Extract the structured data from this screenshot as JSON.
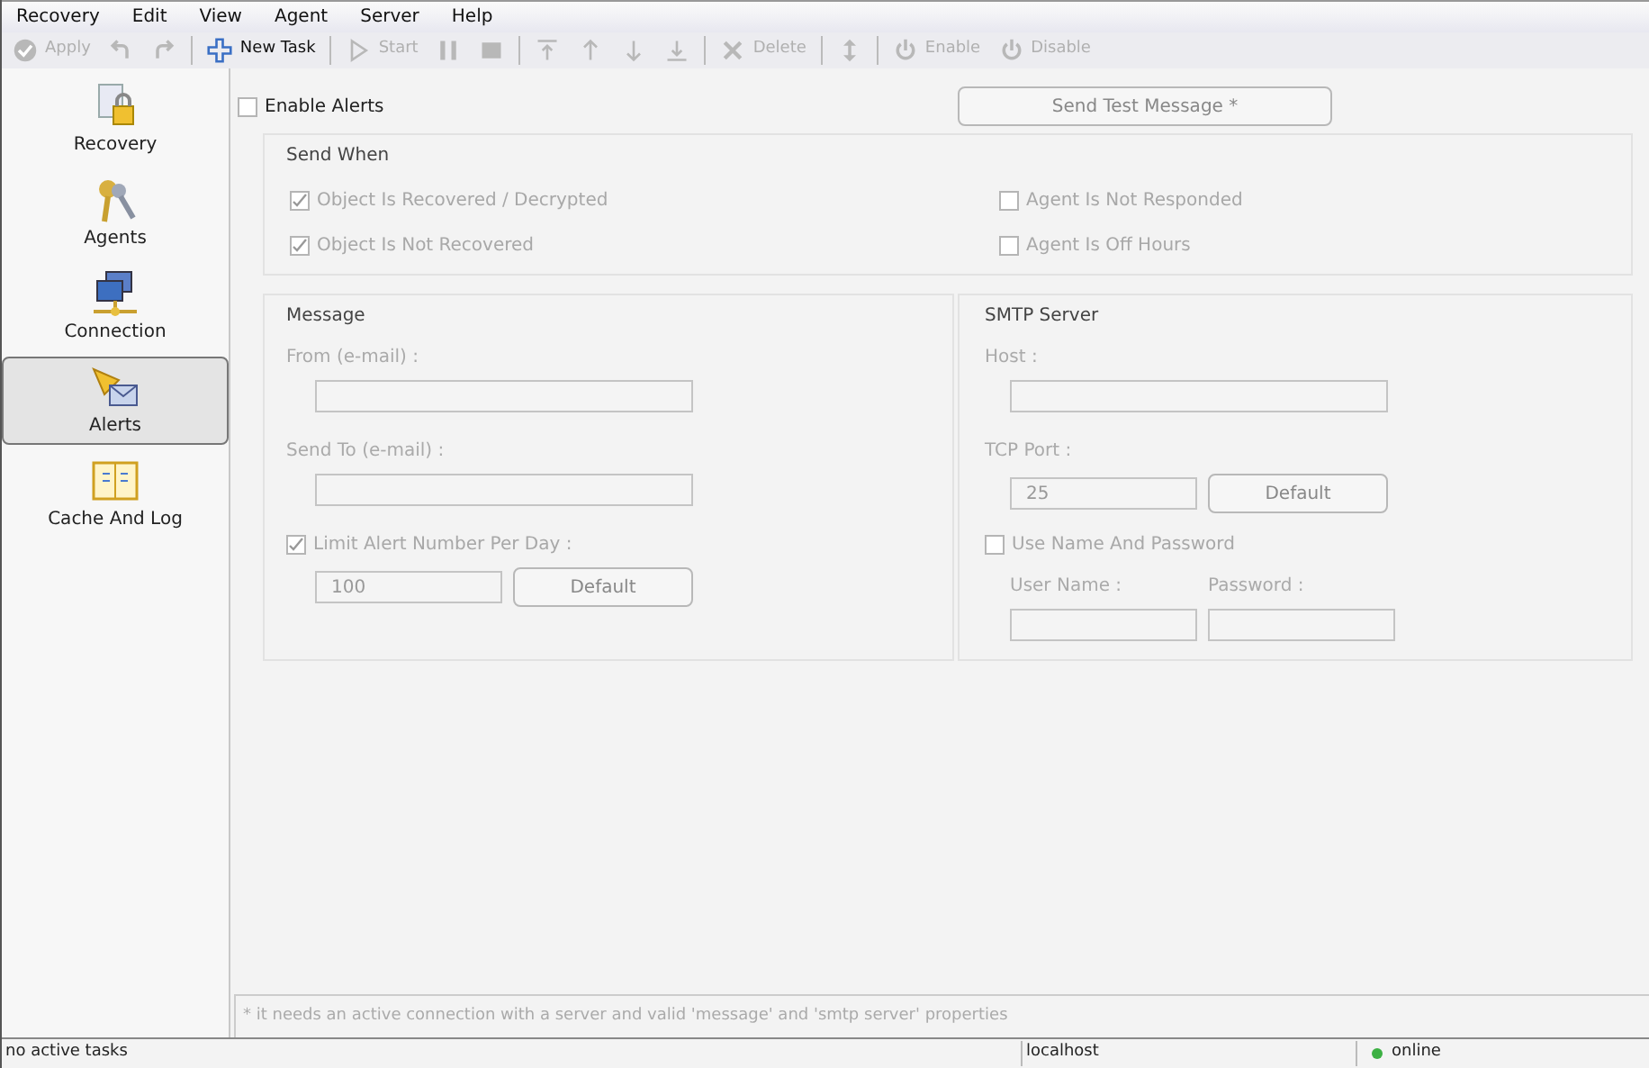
{
  "menu": [
    "Recovery",
    "Edit",
    "View",
    "Agent",
    "Server",
    "Help"
  ],
  "toolbar": [
    {
      "kind": "button",
      "label": "Apply",
      "disabled": true
    },
    {
      "kind": "icon",
      "disabled": true
    },
    {
      "kind": "icon",
      "disabled": true
    },
    {
      "kind": "sep"
    },
    {
      "kind": "button",
      "label": "New Task",
      "disabled": false
    },
    {
      "kind": "sep"
    },
    {
      "kind": "button",
      "label": "Start",
      "disabled": true
    },
    {
      "kind": "icon",
      "disabled": true
    },
    {
      "kind": "icon",
      "disabled": true
    },
    {
      "kind": "sep"
    },
    {
      "kind": "icon",
      "disabled": true
    },
    {
      "kind": "icon",
      "disabled": true
    },
    {
      "kind": "icon",
      "disabled": true
    },
    {
      "kind": "icon",
      "disabled": true
    },
    {
      "kind": "sep"
    },
    {
      "kind": "button",
      "label": "Delete",
      "disabled": true
    },
    {
      "kind": "sep"
    },
    {
      "kind": "icon",
      "disabled": true
    },
    {
      "kind": "sep"
    },
    {
      "kind": "button",
      "label": "Enable",
      "disabled": true
    },
    {
      "kind": "button",
      "label": "Disable",
      "disabled": true
    }
  ],
  "sidebar": {
    "items": [
      {
        "label": "Recovery",
        "selected": false
      },
      {
        "label": "Agents",
        "selected": false
      },
      {
        "label": "Connection",
        "selected": false
      },
      {
        "label": "Alerts",
        "selected": true
      },
      {
        "label": "Cache And Log",
        "selected": false
      }
    ]
  },
  "enable_alerts": {
    "label": "Enable Alerts",
    "checked": false
  },
  "send_test_button": "Send Test Message *",
  "send_when": {
    "title": "Send When",
    "options": [
      {
        "label": "Object Is Recovered / Decrypted",
        "checked": true
      },
      {
        "label": "Agent Is Not Responded",
        "checked": false
      },
      {
        "label": "Object Is Not Recovered",
        "checked": true
      },
      {
        "label": "Agent Is Off Hours",
        "checked": false
      }
    ]
  },
  "message": {
    "title": "Message",
    "from_label": "From (e-mail) :",
    "to_label": "Send To (e-mail) :",
    "limit": {
      "label": "Limit Alert Number Per Day :",
      "checked": true
    },
    "limit_value": "100",
    "default_button": "Default"
  },
  "smtp": {
    "title": "SMTP Server",
    "host_label": "Host :",
    "port_label": "TCP Port :",
    "port_value": "25",
    "default_button": "Default",
    "auth": {
      "label": "Use Name And Password",
      "checked": false
    },
    "user_label": "User Name :",
    "password_label": "Password :"
  },
  "footnote": "* it needs an active connection with a server and valid 'message' and 'smtp server' properties",
  "status_bar": {
    "tasks": "no active tasks",
    "host": "localhost",
    "status": "online"
  }
}
